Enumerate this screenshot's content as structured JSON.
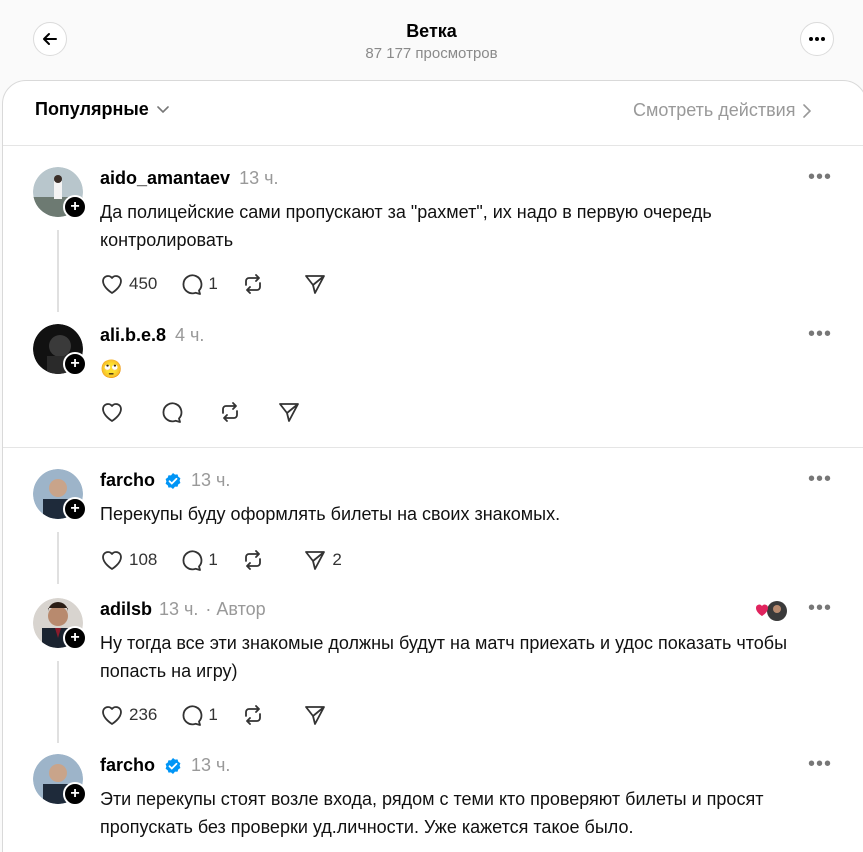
{
  "header": {
    "title": "Ветка",
    "views": "87 177 просмотров"
  },
  "filter": {
    "label": "Популярные",
    "activity_link": "Смотреть действия"
  },
  "posts": [
    {
      "username": "aido_amantaev",
      "time": "13 ч.",
      "text": "Да полицейские сами пропускают за \"рахмет\", их надо в первую очередь контролировать",
      "likes": "450",
      "replies": "1",
      "reposts": "",
      "shares": ""
    },
    {
      "username": "ali.b.e.8",
      "time": "4 ч.",
      "text": "🙄",
      "likes": "",
      "replies": "",
      "reposts": "",
      "shares": ""
    },
    {
      "username": "farcho",
      "time": "13 ч.",
      "text": "Перекупы буду оформлять билеты на своих знакомых.",
      "likes": "108",
      "replies": "1",
      "reposts": "",
      "shares": "2"
    },
    {
      "username": "adilsb",
      "time": "13 ч.",
      "author_badge": "· Автор",
      "text": "Ну тогда все эти знакомые должны будут на матч приехать и удос показать чтобы попасть на игру)",
      "likes": "236",
      "replies": "1",
      "reposts": "",
      "shares": ""
    },
    {
      "username": "farcho",
      "time": "13 ч.",
      "text": "Эти перекупы стоят возле входа, рядом с теми кто проверяют билеты и просят пропускать без проверки уд.личности. Уже кажется такое было."
    }
  ],
  "colors": {
    "verified": "#0095f6",
    "liked_heart": "#e0245e",
    "muted_text": "#999999"
  }
}
